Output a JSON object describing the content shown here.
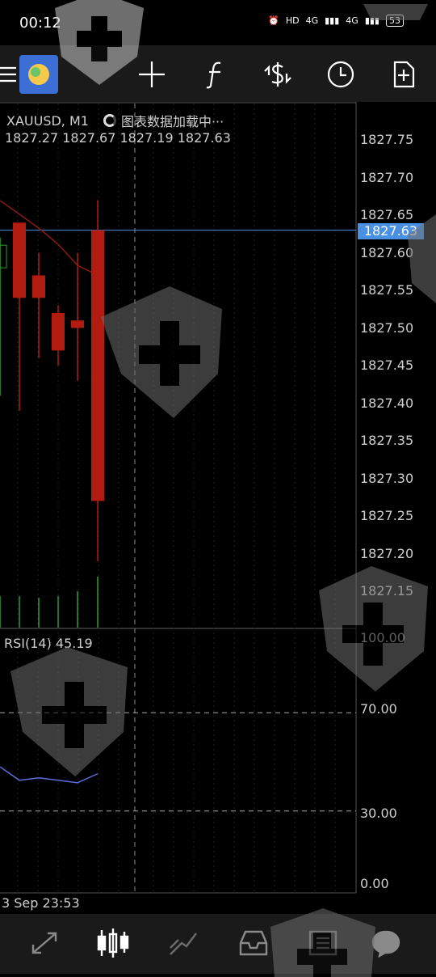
{
  "status": {
    "time": "00:12",
    "network1": "4G",
    "network2": "4G",
    "battery": "53"
  },
  "toolbar": {
    "items": [
      {
        "name": "menu-icon"
      },
      {
        "name": "app-logo-icon"
      },
      {
        "name": "crosshair-icon"
      },
      {
        "name": "indicator-f-icon"
      },
      {
        "name": "symbol-dollar-icon"
      },
      {
        "name": "period-clock-icon"
      },
      {
        "name": "new-object-icon"
      }
    ]
  },
  "chart": {
    "symbol": "XAUUSD, M1",
    "loading_text": "图表数据加载中···",
    "ohlc": "1827.27 1827.67 1827.19 1827.63",
    "price_current": "1827.63",
    "y_ticks": [
      "1827.75",
      "1827.70",
      "1827.65",
      "1827.60",
      "1827.55",
      "1827.50",
      "1827.45",
      "1827.40",
      "1827.35",
      "1827.30",
      "1827.25",
      "1827.20",
      "1827.15"
    ],
    "rsi_label": "RSI(14) 45.19",
    "rsi_ticks": [
      "100.00",
      "70.00",
      "30.00",
      "0.00"
    ],
    "date_label": "3 Sep 23:53",
    "colors": {
      "bear": "#b11b10",
      "bull": "#2ca02c",
      "ma": "#8b1a12",
      "rsi": "#5a6cd6",
      "price_line": "#4a90e2"
    }
  },
  "chart_data": {
    "type": "candlestick",
    "ylim": [
      1827.13,
      1827.77
    ],
    "candles": [
      {
        "open": 1827.58,
        "high": 1827.62,
        "low": 1827.41,
        "close": 1827.61,
        "bull": true
      },
      {
        "open": 1827.64,
        "high": 1827.64,
        "low": 1827.39,
        "close": 1827.54,
        "bull": false
      },
      {
        "open": 1827.57,
        "high": 1827.6,
        "low": 1827.46,
        "close": 1827.54,
        "bull": false
      },
      {
        "open": 1827.52,
        "high": 1827.53,
        "low": 1827.45,
        "close": 1827.47,
        "bull": false
      },
      {
        "open": 1827.51,
        "high": 1827.6,
        "low": 1827.43,
        "close": 1827.5,
        "bull": false
      },
      {
        "open": 1827.63,
        "high": 1827.67,
        "low": 1827.19,
        "close": 1827.27,
        "bull": false
      }
    ],
    "rsi": {
      "period": 14,
      "value": 45.19,
      "levels": [
        70,
        30
      ],
      "range": [
        0,
        100
      ]
    }
  }
}
